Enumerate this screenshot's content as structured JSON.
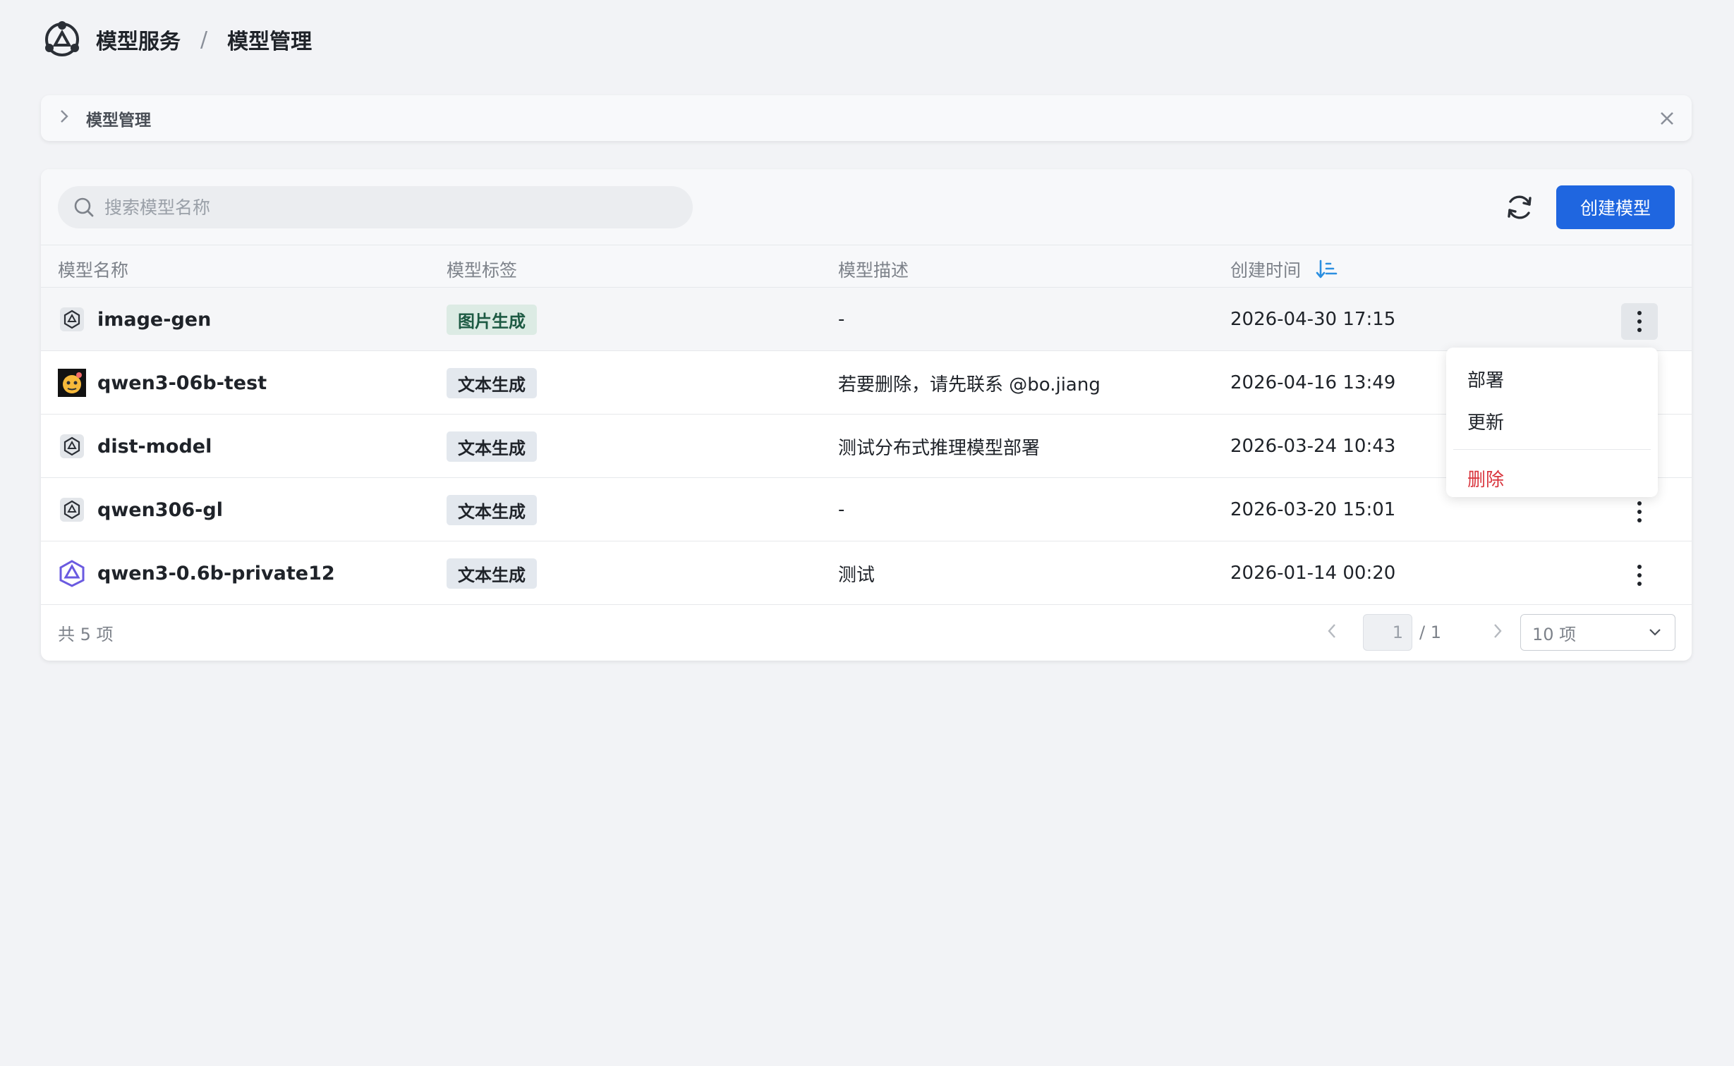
{
  "breadcrumb": {
    "service": "模型服务",
    "sep": "/",
    "current": "模型管理"
  },
  "notice": {
    "text": "模型管理"
  },
  "toolbar": {
    "search_placeholder": "搜索模型名称",
    "create_label": "创建模型"
  },
  "table": {
    "headers": {
      "name": "模型名称",
      "tag": "模型标签",
      "desc": "模型描述",
      "time": "创建时间"
    },
    "rows": [
      {
        "name": "image-gen",
        "tag": "图片生成",
        "desc": "-",
        "time": "2026-04-30 17:15",
        "icon": "model-hex-icon"
      },
      {
        "name": "qwen3-06b-test",
        "tag": "文本生成",
        "desc": "若要删除，请先联系 @bo.jiang",
        "time": "2026-04-16 13:49",
        "icon": "emoji-avatar-icon"
      },
      {
        "name": "dist-model",
        "tag": "文本生成",
        "desc": "测试分布式推理模型部署",
        "time": "2026-03-24 10:43",
        "icon": "model-hex-icon"
      },
      {
        "name": "qwen306-gl",
        "tag": "文本生成",
        "desc": "-",
        "time": "2026-03-20 15:01",
        "icon": "model-hex-icon"
      },
      {
        "name": "qwen3-0.6b-private12",
        "tag": "文本生成",
        "desc": "测试",
        "time": "2026-01-14 00:20",
        "icon": "qwen-logo-icon"
      }
    ]
  },
  "footer": {
    "total": "共 5 项",
    "page": "1",
    "page_total": "/ 1",
    "page_size": "10 项"
  },
  "menu": {
    "deploy": "部署",
    "update": "更新",
    "delete": "删除"
  },
  "colors": {
    "primary": "#1f66e0",
    "danger": "#d9363e",
    "tag_green_bg": "#dcebe4",
    "tag_gray_bg": "#e3e8ee"
  }
}
